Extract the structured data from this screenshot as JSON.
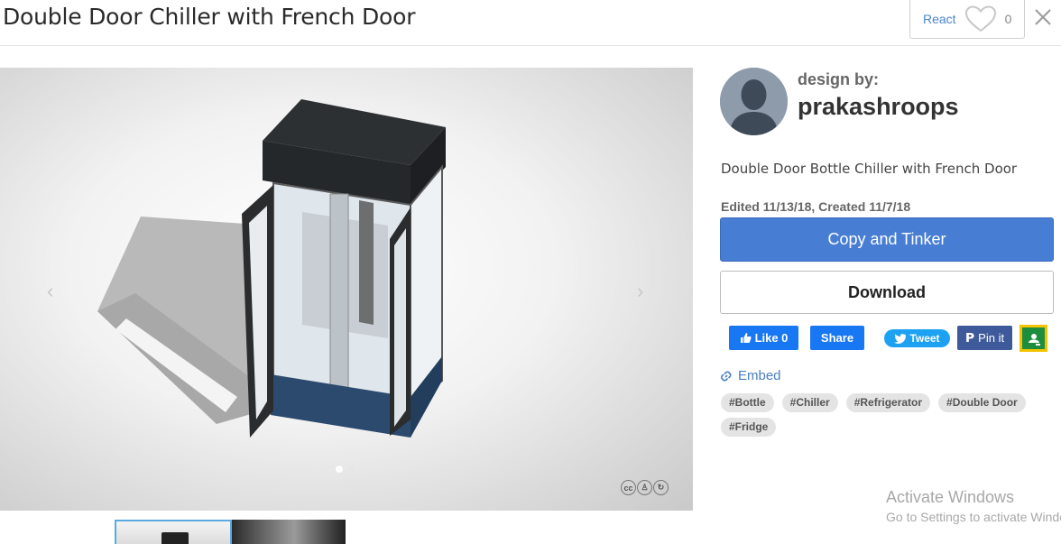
{
  "header": {
    "title": "Double Door Chiller with French Door",
    "react_label": "React",
    "react_count": "0"
  },
  "viewer": {
    "prev_arrow": "‹",
    "next_arrow": "›",
    "license_icons": [
      "cc",
      "by",
      "sa"
    ]
  },
  "designer": {
    "label": "design by:",
    "name": "prakashroops"
  },
  "description": "Double Door Bottle Chiller with French Door",
  "dates": "Edited 11/13/18, Created 11/7/18",
  "actions": {
    "copy_label": "Copy and Tinker",
    "download_label": "Download"
  },
  "social": {
    "like": "Like 0",
    "share": "Share",
    "tweet": "Tweet",
    "pin": "Pin it"
  },
  "embed_label": "Embed",
  "tags": [
    "#Bottle",
    "#Chiller",
    "#Refrigerator",
    "#Double Door",
    "#Fridge"
  ],
  "watermark": {
    "title": "Activate Windows",
    "subtitle": "Go to Settings to activate Windows."
  },
  "colors": {
    "primary": "#477dd3",
    "facebook": "#1877f2",
    "twitter": "#1da1f2",
    "link": "#4a7fbf"
  }
}
